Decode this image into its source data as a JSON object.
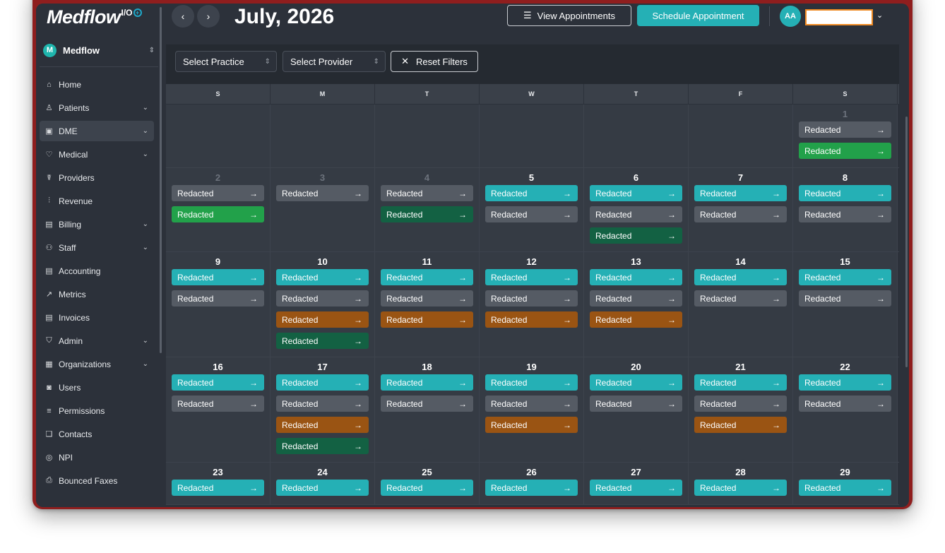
{
  "brand": {
    "name": "Medflow",
    "suffix": "I/O"
  },
  "org": {
    "initial": "M",
    "name": "Medflow"
  },
  "nav": [
    {
      "label": "Home",
      "icon": "home-icon",
      "glyph": "⌂",
      "chevron": false
    },
    {
      "label": "Patients",
      "icon": "user-icon",
      "glyph": "♙",
      "chevron": true
    },
    {
      "label": "DME",
      "icon": "briefcase-icon",
      "glyph": "▣",
      "chevron": true,
      "active": true
    },
    {
      "label": "Medical",
      "icon": "heart-pulse-icon",
      "glyph": "♡",
      "chevron": true
    },
    {
      "label": "Providers",
      "icon": "stethoscope-icon",
      "glyph": "☤",
      "chevron": false
    },
    {
      "label": "Revenue",
      "icon": "bar-chart-icon",
      "glyph": "⫶",
      "chevron": false
    },
    {
      "label": "Billing",
      "icon": "receipt-icon",
      "glyph": "▤",
      "chevron": true
    },
    {
      "label": "Staff",
      "icon": "users-icon",
      "glyph": "⚇",
      "chevron": true
    },
    {
      "label": "Accounting",
      "icon": "file-icon",
      "glyph": "▤",
      "chevron": false
    },
    {
      "label": "Metrics",
      "icon": "trend-icon",
      "glyph": "↗",
      "chevron": false
    },
    {
      "label": "Invoices",
      "icon": "invoice-icon",
      "glyph": "▤",
      "chevron": false
    },
    {
      "label": "Admin",
      "icon": "shield-icon",
      "glyph": "⛉",
      "chevron": true
    },
    {
      "label": "Organizations",
      "icon": "building-icon",
      "glyph": "▦",
      "chevron": true
    },
    {
      "label": "Users",
      "icon": "id-card-icon",
      "glyph": "◙",
      "chevron": false
    },
    {
      "label": "Permissions",
      "icon": "list-icon",
      "glyph": "≡",
      "chevron": false
    },
    {
      "label": "Contacts",
      "icon": "book-icon",
      "glyph": "❑",
      "chevron": false
    },
    {
      "label": "NPI",
      "icon": "fingerprint-icon",
      "glyph": "◎",
      "chevron": false
    },
    {
      "label": "Bounced Faxes",
      "icon": "printer-icon",
      "glyph": "⎙",
      "chevron": false
    }
  ],
  "header": {
    "title": "July, 2026",
    "view_appointments": "View Appointments",
    "schedule_appointment": "Schedule Appointment",
    "user_initials": "AA"
  },
  "filters": {
    "practice": "Select Practice",
    "provider": "Select Provider",
    "reset": "Reset Filters"
  },
  "calendar": {
    "weekdays": [
      "S",
      "M",
      "T",
      "W",
      "T",
      "F",
      "S"
    ],
    "weeks": [
      {
        "days": [
          {
            "num": "",
            "appts": []
          },
          {
            "num": "",
            "appts": []
          },
          {
            "num": "",
            "appts": []
          },
          {
            "num": "",
            "appts": []
          },
          {
            "num": "",
            "appts": []
          },
          {
            "num": "",
            "appts": []
          },
          {
            "num": "1",
            "dim": true,
            "appts": [
              {
                "label": "Redacted",
                "color": "gray"
              },
              {
                "label": "Redacted",
                "color": "green"
              }
            ]
          }
        ]
      },
      {
        "days": [
          {
            "num": "2",
            "dim": true,
            "appts": [
              {
                "label": "Redacted",
                "color": "gray"
              },
              {
                "label": "Redacted",
                "color": "green"
              }
            ]
          },
          {
            "num": "3",
            "dim": true,
            "appts": [
              {
                "label": "Redacted",
                "color": "gray"
              }
            ]
          },
          {
            "num": "4",
            "dim": true,
            "appts": [
              {
                "label": "Redacted",
                "color": "gray"
              },
              {
                "label": "Redacted",
                "color": "dkgreen"
              }
            ]
          },
          {
            "num": "5",
            "appts": [
              {
                "label": "Redacted",
                "color": "teal"
              },
              {
                "label": "Redacted",
                "color": "gray"
              }
            ]
          },
          {
            "num": "6",
            "appts": [
              {
                "label": "Redacted",
                "color": "teal"
              },
              {
                "label": "Redacted",
                "color": "gray"
              },
              {
                "label": "Redacted",
                "color": "dkgreen"
              }
            ]
          },
          {
            "num": "7",
            "appts": [
              {
                "label": "Redacted",
                "color": "teal"
              },
              {
                "label": "Redacted",
                "color": "gray"
              }
            ]
          },
          {
            "num": "8",
            "appts": [
              {
                "label": "Redacted",
                "color": "teal"
              },
              {
                "label": "Redacted",
                "color": "gray"
              }
            ]
          }
        ]
      },
      {
        "days": [
          {
            "num": "9",
            "appts": [
              {
                "label": "Redacted",
                "color": "teal"
              },
              {
                "label": "Redacted",
                "color": "gray"
              }
            ]
          },
          {
            "num": "10",
            "appts": [
              {
                "label": "Redacted",
                "color": "teal"
              },
              {
                "label": "Redacted",
                "color": "gray"
              },
              {
                "label": "Redacted",
                "color": "orange"
              },
              {
                "label": "Redacted",
                "color": "dkgreen"
              }
            ]
          },
          {
            "num": "11",
            "appts": [
              {
                "label": "Redacted",
                "color": "teal"
              },
              {
                "label": "Redacted",
                "color": "gray"
              },
              {
                "label": "Redacted",
                "color": "orange"
              }
            ]
          },
          {
            "num": "12",
            "appts": [
              {
                "label": "Redacted",
                "color": "teal"
              },
              {
                "label": "Redacted",
                "color": "gray"
              },
              {
                "label": "Redacted",
                "color": "orange"
              }
            ]
          },
          {
            "num": "13",
            "appts": [
              {
                "label": "Redacted",
                "color": "teal"
              },
              {
                "label": "Redacted",
                "color": "gray"
              },
              {
                "label": "Redacted",
                "color": "orange"
              }
            ]
          },
          {
            "num": "14",
            "appts": [
              {
                "label": "Redacted",
                "color": "teal"
              },
              {
                "label": "Redacted",
                "color": "gray"
              }
            ]
          },
          {
            "num": "15",
            "appts": [
              {
                "label": "Redacted",
                "color": "teal"
              },
              {
                "label": "Redacted",
                "color": "gray"
              }
            ]
          }
        ]
      },
      {
        "days": [
          {
            "num": "16",
            "appts": [
              {
                "label": "Redacted",
                "color": "teal"
              },
              {
                "label": "Redacted",
                "color": "gray"
              }
            ]
          },
          {
            "num": "17",
            "appts": [
              {
                "label": "Redacted",
                "color": "teal"
              },
              {
                "label": "Redacted",
                "color": "gray"
              },
              {
                "label": "Redacted",
                "color": "orange"
              },
              {
                "label": "Redacted",
                "color": "dkgreen"
              }
            ]
          },
          {
            "num": "18",
            "appts": [
              {
                "label": "Redacted",
                "color": "teal"
              },
              {
                "label": "Redacted",
                "color": "gray"
              }
            ]
          },
          {
            "num": "19",
            "appts": [
              {
                "label": "Redacted",
                "color": "teal"
              },
              {
                "label": "Redacted",
                "color": "gray"
              },
              {
                "label": "Redacted",
                "color": "orange"
              }
            ]
          },
          {
            "num": "20",
            "appts": [
              {
                "label": "Redacted",
                "color": "teal"
              },
              {
                "label": "Redacted",
                "color": "gray"
              }
            ]
          },
          {
            "num": "21",
            "appts": [
              {
                "label": "Redacted",
                "color": "teal"
              },
              {
                "label": "Redacted",
                "color": "gray"
              },
              {
                "label": "Redacted",
                "color": "orange"
              }
            ]
          },
          {
            "num": "22",
            "appts": [
              {
                "label": "Redacted",
                "color": "teal"
              },
              {
                "label": "Redacted",
                "color": "gray"
              }
            ]
          }
        ]
      },
      {
        "days": [
          {
            "num": "23",
            "appts": [
              {
                "label": "Redacted",
                "color": "teal"
              }
            ]
          },
          {
            "num": "24",
            "appts": [
              {
                "label": "Redacted",
                "color": "teal"
              }
            ]
          },
          {
            "num": "25",
            "appts": [
              {
                "label": "Redacted",
                "color": "teal"
              }
            ]
          },
          {
            "num": "26",
            "appts": [
              {
                "label": "Redacted",
                "color": "teal"
              }
            ]
          },
          {
            "num": "27",
            "appts": [
              {
                "label": "Redacted",
                "color": "teal"
              }
            ]
          },
          {
            "num": "28",
            "appts": [
              {
                "label": "Redacted",
                "color": "teal"
              }
            ]
          },
          {
            "num": "29",
            "appts": [
              {
                "label": "Redacted",
                "color": "teal"
              }
            ]
          }
        ]
      }
    ]
  },
  "colors": {
    "teal": "#25b0b5",
    "gray": "#555b64",
    "green": "#22a14a",
    "dkgreen": "#136143",
    "orange": "#9a5413",
    "frame": "#8f1e1e",
    "background": "#2c313a"
  }
}
